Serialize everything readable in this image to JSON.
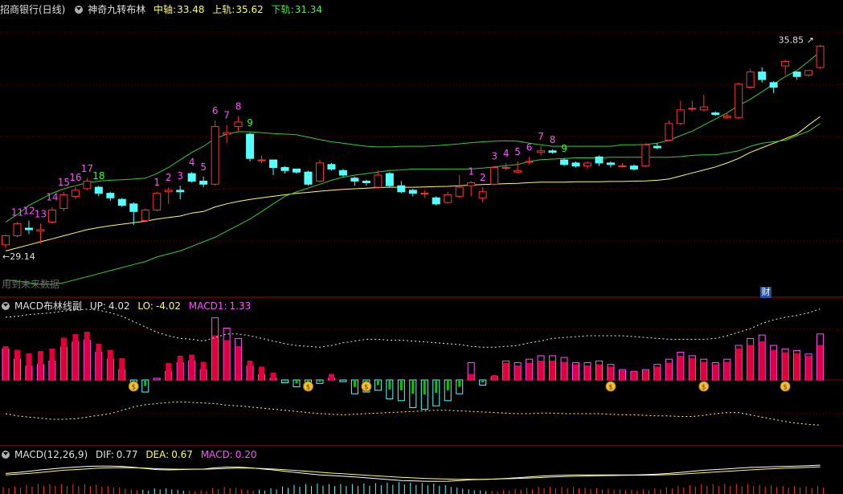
{
  "main": {
    "stock": "招商银行(日线)",
    "indicator": "神奇九转布林",
    "mid_label": "中轴",
    "mid_value": "33.48",
    "up_label": "上轨",
    "up_value": "35.62",
    "dn_label": "下轨",
    "dn_value": "31.34",
    "high_mark": "35.85",
    "low_mark": "29.14",
    "watermark": "用到未来数据",
    "badge": "财"
  },
  "macd_boll": {
    "name": "MACD布林线副",
    "up_label": "UP:",
    "up_value": "4.02",
    "lo_label": "LO:",
    "lo_value": "-4.02",
    "m1_label": "MACD1:",
    "m1_value": "1.33"
  },
  "macd": {
    "name": "MACD(12,26,9)",
    "dif_label": "DIF:",
    "dif_value": "0.77",
    "dea_label": "DEA:",
    "dea_value": "0.67",
    "macd_label": "MACD:",
    "macd_value": "0.20"
  },
  "colors": {
    "up": "#ff3232",
    "down": "#54ffff",
    "mid": "#ffff50",
    "band": "#33cc33",
    "magenta": "#ff50ff",
    "green_num": "#33ff33",
    "bar_green": "#00cc00"
  },
  "candles": [
    [
      29.25,
      29.55,
      29.6,
      29.14
    ],
    [
      29.55,
      29.95,
      30.0,
      29.5
    ],
    [
      29.8,
      29.75,
      30.05,
      29.6
    ],
    [
      29.7,
      29.75,
      29.95,
      29.3
    ],
    [
      30.0,
      30.4,
      30.5,
      29.95
    ],
    [
      30.45,
      30.9,
      31.0,
      30.35
    ],
    [
      30.85,
      31.05,
      31.15,
      30.75
    ],
    [
      31.1,
      31.35,
      31.45,
      31.05
    ],
    [
      31.15,
      30.95,
      31.2,
      30.85
    ],
    [
      30.95,
      30.8,
      31.0,
      30.7
    ],
    [
      30.75,
      30.55,
      30.8,
      30.5
    ],
    [
      30.6,
      30.35,
      30.65,
      29.9
    ],
    [
      30.05,
      30.4,
      30.45,
      30.0
    ],
    [
      30.4,
      30.95,
      31.0,
      30.35
    ],
    [
      31.0,
      31.05,
      31.15,
      30.6
    ],
    [
      31.05,
      31.0,
      31.2,
      30.75
    ],
    [
      31.6,
      31.35,
      31.65,
      31.3
    ],
    [
      31.35,
      31.25,
      31.5,
      31.15
    ],
    [
      31.25,
      33.15,
      33.35,
      31.2
    ],
    [
      32.9,
      32.95,
      33.2,
      32.6
    ],
    [
      33.15,
      33.3,
      33.5,
      33.0
    ],
    [
      32.9,
      32.1,
      32.95,
      32.0
    ],
    [
      32.05,
      32.05,
      32.2,
      31.95
    ],
    [
      32.05,
      31.8,
      32.05,
      31.55
    ],
    [
      31.8,
      31.7,
      31.85,
      31.6
    ],
    [
      31.75,
      31.65,
      31.75,
      31.6
    ],
    [
      31.65,
      31.25,
      31.7,
      31.2
    ],
    [
      31.35,
      31.95,
      32.05,
      31.3
    ],
    [
      31.9,
      31.75,
      31.95,
      31.7
    ],
    [
      31.7,
      31.55,
      31.75,
      31.5
    ],
    [
      31.45,
      31.35,
      31.5,
      31.2
    ],
    [
      31.35,
      31.3,
      31.4,
      31.2
    ],
    [
      31.15,
      31.55,
      31.7,
      31.1
    ],
    [
      31.6,
      31.2,
      31.65,
      31.15
    ],
    [
      31.2,
      31.0,
      31.35,
      30.95
    ],
    [
      31.05,
      30.95,
      31.1,
      30.85
    ],
    [
      30.95,
      30.95,
      31.05,
      30.8
    ],
    [
      30.8,
      30.6,
      30.85,
      30.55
    ],
    [
      30.65,
      30.9,
      31.0,
      30.6
    ],
    [
      30.85,
      31.15,
      31.55,
      30.8
    ],
    [
      31.2,
      31.3,
      31.35,
      30.85
    ],
    [
      30.8,
      31.0,
      31.15,
      30.65
    ],
    [
      31.25,
      31.8,
      31.85,
      31.2
    ],
    [
      31.8,
      31.8,
      31.95,
      31.7
    ],
    [
      31.65,
      31.7,
      32.0,
      31.6
    ],
    [
      32.0,
      32.0,
      32.15,
      31.9
    ],
    [
      32.3,
      32.35,
      32.5,
      32.2
    ],
    [
      32.35,
      32.3,
      32.4,
      32.25
    ],
    [
      32.05,
      31.9,
      32.1,
      31.85
    ],
    [
      31.95,
      31.85,
      32.0,
      31.8
    ],
    [
      31.85,
      31.95,
      32.0,
      31.75
    ],
    [
      32.15,
      31.95,
      32.2,
      31.85
    ],
    [
      31.95,
      31.9,
      32.0,
      31.8
    ],
    [
      31.85,
      31.85,
      31.95,
      31.8
    ],
    [
      31.85,
      31.75,
      31.9,
      31.7
    ],
    [
      31.85,
      32.55,
      32.6,
      31.8
    ],
    [
      32.5,
      32.45,
      32.6,
      32.4
    ],
    [
      32.7,
      33.25,
      33.35,
      32.65
    ],
    [
      33.25,
      33.7,
      34.0,
      33.2
    ],
    [
      33.75,
      33.75,
      34.0,
      33.65
    ],
    [
      33.7,
      33.8,
      34.2,
      33.65
    ],
    [
      33.6,
      33.55,
      33.65,
      33.5
    ],
    [
      33.45,
      33.5,
      33.6,
      33.4
    ],
    [
      33.45,
      34.55,
      34.6,
      33.4
    ],
    [
      34.45,
      34.95,
      35.05,
      34.4
    ],
    [
      34.95,
      34.7,
      35.1,
      34.6
    ],
    [
      34.6,
      34.45,
      34.65,
      34.25
    ],
    [
      35.15,
      35.3,
      35.35,
      34.85
    ],
    [
      34.95,
      34.8,
      34.95,
      34.7
    ],
    [
      34.85,
      35.0,
      35.0,
      34.8
    ],
    [
      35.1,
      35.8,
      35.85,
      35.05
    ]
  ],
  "mid_series": [
    29.05,
    29.15,
    29.25,
    29.35,
    29.45,
    29.55,
    29.65,
    29.75,
    29.82,
    29.88,
    29.93,
    29.98,
    30.03,
    30.1,
    30.15,
    30.2,
    30.3,
    30.35,
    30.5,
    30.6,
    30.68,
    30.75,
    30.8,
    30.85,
    30.9,
    30.95,
    30.98,
    31.02,
    31.05,
    31.08,
    31.1,
    31.12,
    31.14,
    31.15,
    31.15,
    31.15,
    31.16,
    31.17,
    31.18,
    31.2,
    31.22,
    31.24,
    31.25,
    31.27,
    31.28,
    31.3,
    31.32,
    31.32,
    31.32,
    31.33,
    31.33,
    31.33,
    31.34,
    31.34,
    31.35,
    31.36,
    31.38,
    31.42,
    31.52,
    31.62,
    31.72,
    31.82,
    31.95,
    32.1,
    32.3,
    32.45,
    32.6,
    32.75,
    32.9,
    33.2,
    33.48
  ],
  "up_series": [
    30.0,
    30.25,
    30.55,
    30.75,
    30.95,
    31.1,
    31.2,
    31.3,
    31.35,
    31.38,
    31.4,
    31.42,
    31.45,
    31.6,
    31.8,
    32.05,
    32.3,
    32.5,
    32.75,
    32.9,
    32.98,
    32.98,
    32.95,
    32.92,
    32.9,
    32.88,
    32.8,
    32.72,
    32.65,
    32.6,
    32.55,
    32.5,
    32.48,
    32.48,
    32.5,
    32.5,
    32.5,
    32.52,
    32.55,
    32.58,
    32.62,
    32.65,
    32.67,
    32.68,
    32.67,
    32.6,
    32.55,
    32.5,
    32.5,
    32.5,
    32.5,
    32.5,
    32.5,
    32.55,
    32.55,
    32.56,
    32.6,
    32.7,
    32.85,
    33.0,
    33.2,
    33.4,
    33.6,
    33.85,
    34.05,
    34.3,
    34.55,
    34.8,
    35.0,
    35.3,
    35.62
  ],
  "dn_series": [
    28.1,
    28.05,
    28.0,
    27.95,
    27.95,
    28.0,
    28.1,
    28.2,
    28.3,
    28.4,
    28.5,
    28.6,
    28.7,
    28.85,
    28.95,
    29.05,
    29.2,
    29.35,
    29.5,
    29.7,
    29.9,
    30.1,
    30.35,
    30.6,
    30.85,
    31.0,
    31.12,
    31.25,
    31.38,
    31.48,
    31.55,
    31.6,
    31.65,
    31.7,
    31.72,
    31.75,
    31.75,
    31.75,
    31.75,
    31.75,
    31.75,
    31.78,
    31.82,
    31.86,
    31.9,
    32.0,
    32.06,
    32.08,
    32.1,
    32.12,
    32.12,
    32.12,
    32.14,
    32.14,
    32.14,
    32.14,
    32.14,
    32.14,
    32.16,
    32.2,
    32.22,
    32.22,
    32.28,
    32.35,
    32.5,
    32.6,
    32.65,
    32.7,
    32.85,
    33.0,
    33.25,
    33.4,
    31.34
  ],
  "nine_marks": [
    [
      1,
      "11",
      0
    ],
    [
      2,
      "12",
      0
    ],
    [
      3,
      "13",
      0
    ],
    [
      4,
      "14",
      0
    ],
    [
      5,
      "15",
      0
    ],
    [
      6,
      "16",
      0
    ],
    [
      7,
      "17",
      0
    ],
    [
      8,
      "18",
      1
    ],
    [
      13,
      "1",
      0
    ],
    [
      14,
      "2",
      0
    ],
    [
      15,
      "3",
      0
    ],
    [
      16,
      "4",
      0
    ],
    [
      17,
      "5",
      0
    ],
    [
      18,
      "6",
      0
    ],
    [
      19,
      "7",
      0
    ],
    [
      20,
      "8",
      0
    ],
    [
      21,
      "9",
      1
    ],
    [
      40,
      "1",
      0
    ],
    [
      41,
      "2",
      0
    ],
    [
      42,
      "3",
      0
    ],
    [
      43,
      "4",
      0
    ],
    [
      44,
      "5",
      0
    ],
    [
      45,
      "6",
      0
    ],
    [
      46,
      "7",
      0
    ],
    [
      47,
      "8",
      0
    ],
    [
      48,
      "9",
      1
    ]
  ],
  "macd_hist": [
    0.9,
    0.6,
    0.4,
    0.45,
    0.55,
    0.95,
    1.1,
    1.15,
    0.8,
    0.6,
    0.3,
    -0.25,
    -0.35,
    0.0,
    0.25,
    0.5,
    0.55,
    0.3,
    1.8,
    1.5,
    1.2,
    0.4,
    0.15,
    0.05,
    -0.08,
    -0.2,
    -0.25,
    -0.1,
    0.05,
    -0.05,
    -0.4,
    -0.35,
    -0.3,
    -0.55,
    -0.6,
    -0.8,
    -0.85,
    -0.75,
    -0.6,
    -0.4,
    0.5,
    -0.15,
    0.1,
    0.55,
    0.5,
    0.6,
    0.7,
    0.7,
    0.65,
    0.5,
    0.5,
    0.55,
    0.45,
    0.3,
    0.25,
    0.3,
    0.45,
    0.6,
    0.8,
    0.7,
    0.6,
    0.5,
    0.6,
    1.0,
    1.2,
    1.3,
    1.0,
    0.9,
    0.85,
    0.75,
    1.33
  ],
  "macd_pos_h": [
    56,
    50,
    44,
    48,
    52,
    70,
    76,
    80,
    60,
    50,
    36,
    0,
    0,
    0,
    28,
    40,
    42,
    30,
    74,
    66,
    56,
    32,
    22,
    12,
    0,
    0,
    0,
    0,
    10,
    0,
    0,
    0,
    0,
    0,
    0,
    0,
    0,
    0,
    0,
    0,
    10,
    0,
    8,
    28,
    24,
    28,
    32,
    32,
    30,
    26,
    24,
    26,
    22,
    16,
    14,
    16,
    22,
    28,
    40,
    36,
    30,
    26,
    30,
    52,
    58,
    64,
    50,
    46,
    44,
    40,
    58
  ],
  "money_bags": [
    11,
    26,
    31,
    52,
    60,
    67
  ],
  "boll_up_line": [
    3.55,
    3.6,
    3.7,
    3.75,
    3.8,
    3.9,
    3.95,
    4.0,
    3.95,
    3.8,
    3.6,
    3.3,
    3.0,
    2.7,
    2.5,
    2.35,
    2.3,
    2.2,
    2.4,
    2.6,
    2.6,
    2.5,
    2.35,
    2.2,
    2.05,
    1.95,
    1.9,
    1.85,
    1.95,
    2.1,
    2.2,
    2.3,
    2.3,
    2.25,
    2.25,
    2.2,
    2.15,
    2.1,
    2.05,
    2.0,
    1.9,
    1.85,
    1.85,
    1.9,
    1.95,
    2.1,
    2.2,
    2.35,
    2.4,
    2.45,
    2.5,
    2.5,
    2.5,
    2.5,
    2.45,
    2.4,
    2.35,
    2.3,
    2.3,
    2.3,
    2.3,
    2.35,
    2.5,
    2.7,
    2.9,
    3.2,
    3.4,
    3.55,
    3.65,
    3.8,
    4.02
  ],
  "boll_lo_line": [
    -3.0,
    -3.2,
    -3.3,
    -3.4,
    -3.5,
    -3.5,
    -3.45,
    -3.3,
    -3.15,
    -3.0,
    -2.7,
    -2.4,
    -2.2,
    -2.1,
    -2.0,
    -1.95,
    -2.0,
    -2.05,
    -2.1,
    -2.25,
    -2.3,
    -2.4,
    -2.5,
    -2.6,
    -2.7,
    -2.8,
    -2.9,
    -3.0,
    -3.05,
    -3.1,
    -3.05,
    -3.0,
    -2.95,
    -2.9,
    -2.85,
    -2.8,
    -2.75,
    -2.7,
    -2.7,
    -2.75,
    -2.8,
    -2.85,
    -2.9,
    -2.95,
    -3.0,
    -3.0,
    -2.95,
    -2.95,
    -3.0,
    -3.0,
    -3.0,
    -3.0,
    -3.05,
    -3.1,
    -3.1,
    -3.15,
    -3.2,
    -3.2,
    -3.25,
    -3.25,
    -3.15,
    -3.0,
    -2.9,
    -2.9,
    -3.1,
    -3.3,
    -3.5,
    -3.7,
    -3.85,
    -3.95,
    -4.02
  ],
  "dif_line": [
    0.3,
    0.35,
    0.42,
    0.5,
    0.56,
    0.62,
    0.66,
    0.7,
    0.72,
    0.72,
    0.7,
    0.65,
    0.58,
    0.52,
    0.5,
    0.52,
    0.54,
    0.55,
    0.62,
    0.66,
    0.66,
    0.62,
    0.56,
    0.5,
    0.42,
    0.35,
    0.28,
    0.22,
    0.18,
    0.14,
    0.1,
    0.05,
    0.0,
    -0.05,
    -0.1,
    -0.12,
    -0.14,
    -0.15,
    -0.14,
    -0.1,
    -0.06,
    -0.04,
    -0.02,
    0.02,
    0.06,
    0.1,
    0.15,
    0.18,
    0.2,
    0.22,
    0.22,
    0.22,
    0.22,
    0.22,
    0.22,
    0.23,
    0.26,
    0.3,
    0.36,
    0.42,
    0.48,
    0.52,
    0.56,
    0.6,
    0.64,
    0.66,
    0.68,
    0.7,
    0.72,
    0.74,
    0.77
  ],
  "dea_line": [
    0.22,
    0.26,
    0.3,
    0.36,
    0.42,
    0.48,
    0.52,
    0.56,
    0.6,
    0.62,
    0.63,
    0.62,
    0.6,
    0.57,
    0.55,
    0.54,
    0.54,
    0.54,
    0.56,
    0.58,
    0.6,
    0.6,
    0.58,
    0.55,
    0.51,
    0.47,
    0.42,
    0.37,
    0.32,
    0.28,
    0.24,
    0.2,
    0.16,
    0.12,
    0.08,
    0.05,
    0.02,
    0.0,
    -0.02,
    -0.03,
    -0.03,
    -0.03,
    -0.02,
    0.0,
    0.02,
    0.04,
    0.07,
    0.1,
    0.12,
    0.14,
    0.16,
    0.17,
    0.18,
    0.19,
    0.2,
    0.2,
    0.21,
    0.23,
    0.26,
    0.3,
    0.34,
    0.38,
    0.42,
    0.46,
    0.5,
    0.54,
    0.57,
    0.6,
    0.62,
    0.65,
    0.67
  ]
}
